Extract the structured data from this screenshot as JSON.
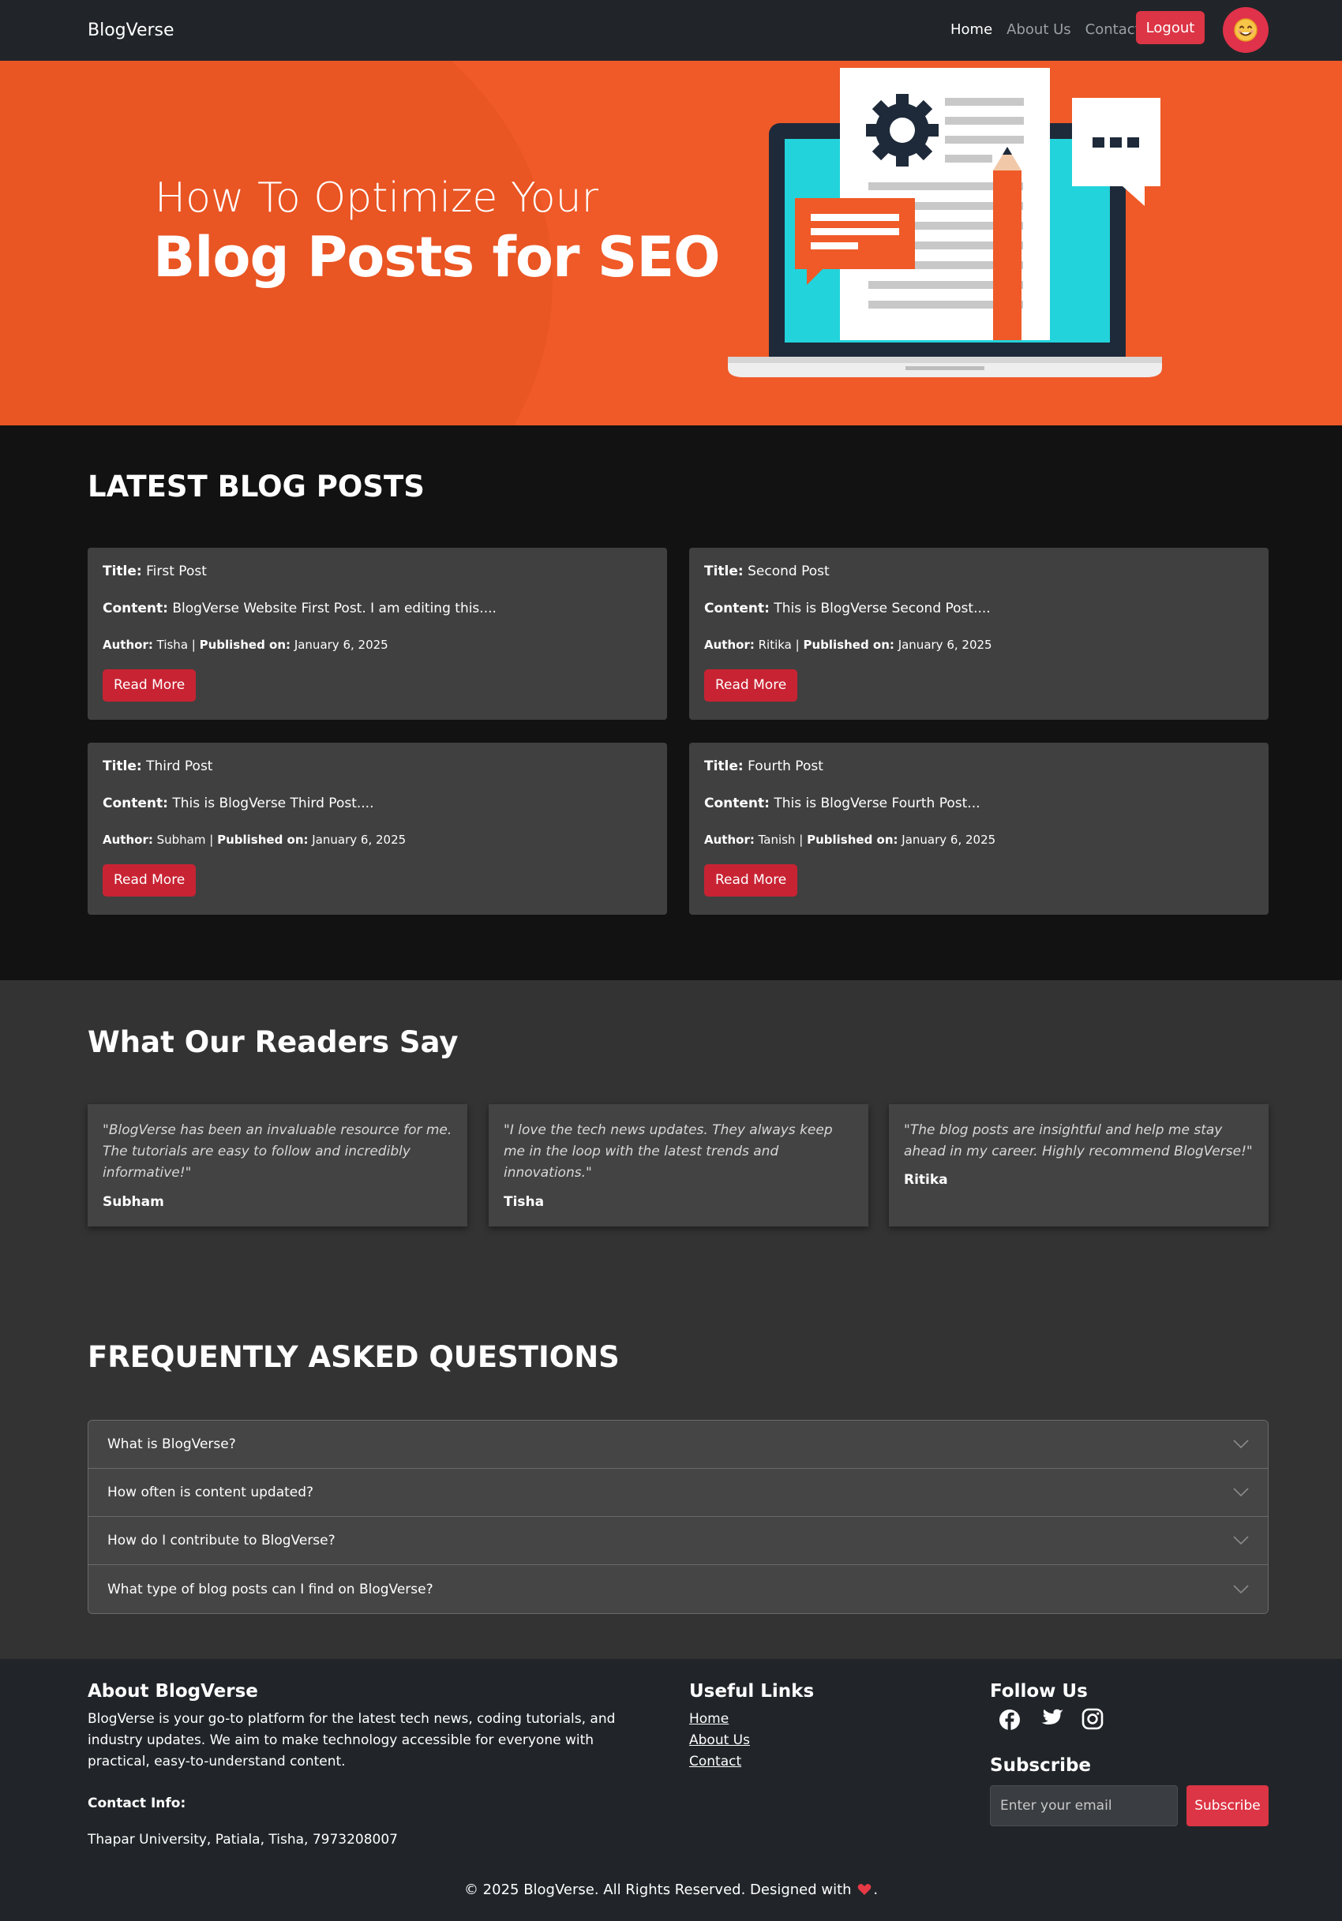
{
  "navbar": {
    "brand": "BlogVerse",
    "links": [
      "Home",
      "About Us",
      "Contact"
    ],
    "logout_label": "Logout",
    "avatar_icon": "smiling-face-icon"
  },
  "hero": {
    "line1": "How To Optimize Your",
    "line2": "Blog Posts for SEO"
  },
  "latest": {
    "title": "LATEST BLOG POSTS",
    "labels": {
      "title": "Title:",
      "content": "Content:",
      "author": "Author:",
      "published": "Published on:"
    },
    "read_more": "Read More",
    "posts": [
      {
        "title": "First Post",
        "content": "BlogVerse Website First Post. I am editing this....",
        "author": "Tisha",
        "date": "January 6, 2025"
      },
      {
        "title": "Second Post",
        "content": "This is BlogVerse Second Post....",
        "author": "Ritika",
        "date": "January 6, 2025"
      },
      {
        "title": "Third Post",
        "content": "This is BlogVerse Third Post....",
        "author": "Subham",
        "date": "January 6, 2025"
      },
      {
        "title": "Fourth Post",
        "content": "This is BlogVerse Fourth Post...",
        "author": "Tanish",
        "date": "January 6, 2025"
      }
    ]
  },
  "readers": {
    "title": "What Our Readers Say",
    "testimonials": [
      {
        "quote": "\"BlogVerse has been an invaluable resource for me. The tutorials are easy to follow and incredibly informative!\"",
        "name": "Subham"
      },
      {
        "quote": "\"I love the tech news updates. They always keep me in the loop with the latest trends and innovations.\"",
        "name": "Tisha"
      },
      {
        "quote": "\"The blog posts are insightful and help me stay ahead in my career. Highly recommend BlogVerse!\"",
        "name": "Ritika"
      }
    ]
  },
  "faq": {
    "title": "FREQUENTLY ASKED QUESTIONS",
    "items": [
      "What is BlogVerse?",
      "How often is content updated?",
      "How do I contribute to BlogVerse?",
      "What type of blog posts can I find on BlogVerse?"
    ]
  },
  "footer": {
    "about_title": "About BlogVerse",
    "about_text": "BlogVerse is your go-to platform for the latest tech news, coding tutorials, and industry updates. We aim to make technology accessible for everyone with practical, easy-to-understand content.",
    "contact_label": "Contact Info:",
    "contact_text": "Thapar University, Patiala, Tisha, 7973208007",
    "links_title": "Useful Links",
    "links": [
      "Home",
      "About Us",
      "Contact"
    ],
    "follow_title": "Follow Us",
    "social_icons": [
      "facebook-icon",
      "twitter-icon",
      "instagram-icon"
    ],
    "subscribe_title": "Subscribe",
    "email_placeholder": "Enter your email",
    "subscribe_label": "Subscribe",
    "copyright": "© 2025 BlogVerse. All Rights Reserved. Designed with",
    "copyright_end": "."
  }
}
